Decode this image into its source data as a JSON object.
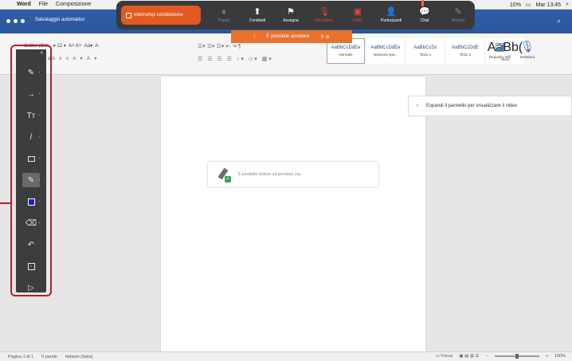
{
  "menubar": {
    "app": "Word",
    "items": [
      "File",
      "Composizione"
    ],
    "battery": "10%",
    "clock": "Mar 13:45"
  },
  "titlebar": {
    "autosave": "Salvataggio automatico"
  },
  "sharebar": {
    "stop_label": "Interrompi condivisione",
    "buttons": [
      {
        "label": "Pausa",
        "icon": "pause-icon",
        "glyph": "⏸",
        "state": "dim"
      },
      {
        "label": "Condividi",
        "icon": "share-screen-icon",
        "glyph": "⬆",
        "state": "normal"
      },
      {
        "label": "Assegna",
        "icon": "assign-icon",
        "glyph": "⚑",
        "state": "normal"
      },
      {
        "label": "Microfono",
        "icon": "mic-icon",
        "glyph": "🎙",
        "state": "red"
      },
      {
        "label": "Video",
        "icon": "video-icon",
        "glyph": "▣",
        "state": "red"
      },
      {
        "label": "Partecipanti",
        "icon": "participants-icon",
        "glyph": "👤",
        "state": "normal"
      },
      {
        "label": "Chat",
        "icon": "chat-icon",
        "glyph": "💬",
        "state": "normal"
      },
      {
        "label": "Annota",
        "icon": "annotate-icon",
        "glyph": "✎",
        "state": "dim"
      }
    ],
    "annotation_banner": "È possibile annotare",
    "colors": {
      "bar": "#3a3a3c",
      "accent": "#e25a22"
    }
  },
  "ribbon": {
    "font_name": "Calibri (Cor...",
    "font_size": "12",
    "styles": [
      {
        "preview": "AaBbCcDdEe",
        "name": "Normale",
        "selected": true
      },
      {
        "preview": "AaBbCcDdEe",
        "name": "Nessuna spa...",
        "selected": false
      },
      {
        "preview": "AaBbCcDc",
        "name": "Titolo 1",
        "selected": false
      },
      {
        "preview": "AaBbCcDdE",
        "name": "Titolo 2",
        "selected": false
      },
      {
        "preview": "AaBb(",
        "name": "Titolo",
        "selected": false
      }
    ],
    "tools": [
      {
        "label": "Riquadro Stili",
        "icon": "styles-pane-icon"
      },
      {
        "label": "Dettatura",
        "icon": "dictate-icon"
      }
    ]
  },
  "document": {
    "hint": "È possibile iniziare ad annotare ora."
  },
  "video_panel": {
    "label": "Espandi il pannello per visualizzare il video"
  },
  "palette": {
    "tools": [
      {
        "name": "pen-tool-icon",
        "glyph": "✎"
      },
      {
        "name": "arrow-tool-icon",
        "glyph": "→"
      },
      {
        "name": "text-tool-icon",
        "glyph": "Tт"
      },
      {
        "name": "line-tool-icon",
        "glyph": "/"
      },
      {
        "name": "shape-tool-icon",
        "glyph": "sq"
      },
      {
        "name": "highlighter-tool-icon",
        "glyph": "✎",
        "active": true
      },
      {
        "name": "color-picker-icon",
        "glyph": "color"
      },
      {
        "name": "eraser-tool-icon",
        "glyph": "⌫"
      },
      {
        "name": "undo-icon",
        "glyph": "↶"
      },
      {
        "name": "save-icon",
        "glyph": "box"
      },
      {
        "name": "pointer-tool-icon",
        "glyph": "▷"
      }
    ],
    "color": "#1a22c8"
  },
  "statusbar": {
    "page": "Pagina 1 di 1",
    "words": "0 parole",
    "language": "Italiano (Italia)",
    "focus": "Focus",
    "zoom": "100%"
  }
}
